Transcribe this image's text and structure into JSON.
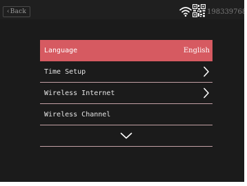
{
  "topbar": {
    "back_label": "Back",
    "device_id": "1983397686"
  },
  "menu": {
    "items": [
      {
        "label": "Language",
        "value": "English",
        "active": true
      },
      {
        "label": "Time Setup",
        "value": ""
      },
      {
        "label": "Wireless Internet",
        "value": ""
      },
      {
        "label": "Wireless Channel",
        "value": ""
      }
    ]
  },
  "colors": {
    "background": "#1b1b1b",
    "accent": "#d65a61",
    "divider": "#c4a2a6",
    "text": "#e6e6e6"
  },
  "icons": {
    "back": "chevron-left-icon",
    "wifi": "wifi-icon",
    "qr": "qr-code-icon",
    "next": "chevron-right-icon",
    "more": "chevron-down-icon"
  }
}
